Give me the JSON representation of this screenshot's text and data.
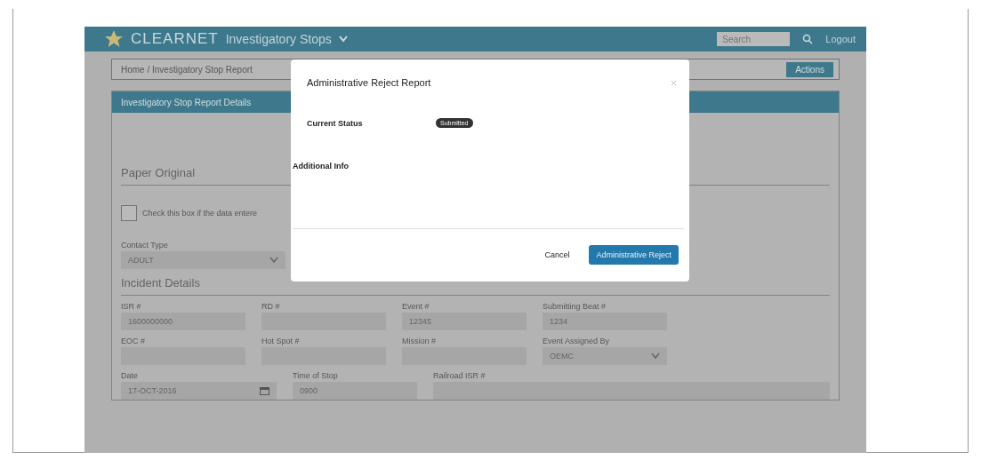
{
  "app_bar": {
    "brand": "CLEARNET",
    "module": "Investigatory Stops",
    "search_placeholder": "Search",
    "links": [
      "Logout"
    ]
  },
  "breadcrumb": {
    "text": "Home / Investigatory Stop Report",
    "action": "Actions"
  },
  "panel": {
    "title": "Investigatory Stop Report Details"
  },
  "paper_original": {
    "heading": "Paper Original",
    "checkbox_label": "Check this box if the data entere",
    "checked": false
  },
  "contact_type": {
    "label": "Contact Type",
    "value": "ADULT"
  },
  "incident_details": {
    "heading": "Incident Details",
    "rows": [
      [
        {
          "label": "ISR #",
          "value": "1600000000",
          "kind": "text"
        },
        {
          "label": "RD #",
          "kind": "text"
        },
        {
          "label": "Event #",
          "value": "12345",
          "kind": "text"
        },
        {
          "label": "Submitting Beat #",
          "value": "1234",
          "kind": "text"
        }
      ],
      [
        {
          "label": "EOC #",
          "kind": "text"
        },
        {
          "label": "Hot Spot #",
          "kind": "text"
        },
        {
          "label": "Mission #",
          "kind": "text"
        },
        {
          "label": "Event Assigned By",
          "value": "OEMC",
          "kind": "select"
        }
      ],
      [
        {
          "label": "Date",
          "value": "17-OCT-2016",
          "kind": "date"
        },
        {
          "label": "Time of Stop",
          "value": "0900",
          "kind": "text"
        },
        {
          "label": "Railroad ISR #",
          "kind": "wide"
        }
      ]
    ]
  },
  "modal": {
    "title": "Administrative Reject Report",
    "status_label": "Current Status",
    "status": "Submitted",
    "info_label": "Additional Info",
    "buttons": [
      {
        "label": "Cancel",
        "kind": "link"
      },
      {
        "label": "Administrative Reject",
        "kind": "primary"
      }
    ]
  }
}
